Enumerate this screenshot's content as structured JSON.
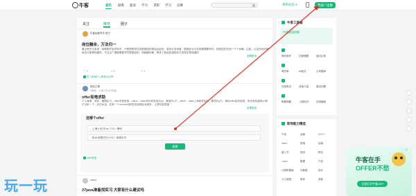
{
  "header": {
    "logo_text": "牛客",
    "nav": [
      "首页",
      "题库",
      "面试",
      "学习",
      "求职",
      "学习",
      "竞赛"
    ],
    "search_placeholder": "",
    "publish_label": "发布动态 ▾",
    "login_label": "登录 / 注册"
  },
  "feed": {
    "tabs": [
      "关注",
      "推荐",
      "圈子"
    ],
    "post1": {
      "author": "牛客运营专员 官方",
      "meta": "",
      "title": "岗位融合，万法归一",
      "body": "最近有些兄弟说：就像刚开始学软件，只是把刚学过的数据结构再结合起来，各种业务场景、数据变化与实现都需要学好，把底层的东西一个个拆解。比如，以及所有的框架设计都是相通的，不过这个课程需要学好数据结构，再细细拆解，看多了就会知道很多东西其实是相通的",
      "more": "查看更多",
      "stats": [
        "2",
        "1",
        "1"
      ],
      "tag": "员工和用户入职成长分享"
    },
    "post2": {
      "author": "邱谈之神",
      "meta": "1周前 · 上海  211/2025届",
      "title": "offer有啥求助",
      "body": "个人背景：双本，暑期实习，offer多种选择，offer1：base杭州研发岗位sp，薪资约x万；offer2：base上海研发岗位，薪资约y万，两份offer如何选择，有没有知道的uu帮忙分析一下，实在纠结，还有一个mentor说研发岗前期比较难升，上限可能很高",
      "more": "查看更多",
      "quiz_title": "选哪个offer",
      "quiz_options": [
        "上海 小红书 sx 7*15 = 腾讯",
        "杭州 阿里巴巴 k*15 = 网易字节"
      ],
      "vote_label": "投票",
      "tag": "offer求选"
    },
    "post3": {
      "author": "cuec1",
      "meta": "",
      "title": "27java准备找实习 大家有什么建议吗"
    }
  },
  "right": {
    "card1_title": "牛客工具箱",
    "card1_items": [
      "简历制作",
      "日程提醒",
      "面试记录",
      "简历库",
      "AI面试",
      "公司题库",
      "在线笔试",
      "自我介绍",
      "面试问题",
      "刷题神器",
      "八股知识",
      "在线编程"
    ],
    "card1_banner": "牛客校园招聘",
    "card2_title": "职场能力精选",
    "card2_rows": [
      [
        "产品",
        "运营",
        "C/C++"
      ],
      [
        "Java",
        "前端",
        "后端"
      ],
      [
        "嵌入式",
        "测试",
        "算法"
      ],
      [
        "Linux",
        "数据",
        "产品"
      ],
      [
        "计算机基础",
        "大数据",
        "设计"
      ],
      [
        "人力资源",
        "财务",
        "其他"
      ]
    ]
  },
  "promo": {
    "line1": "牛客在手",
    "line2": "OFFER不愁",
    "button": "立即打开牛客APP",
    "close": "×"
  },
  "watermark": "玩一玩",
  "colors": {
    "accent": "#19b87a",
    "arrow": "#d9342b"
  }
}
